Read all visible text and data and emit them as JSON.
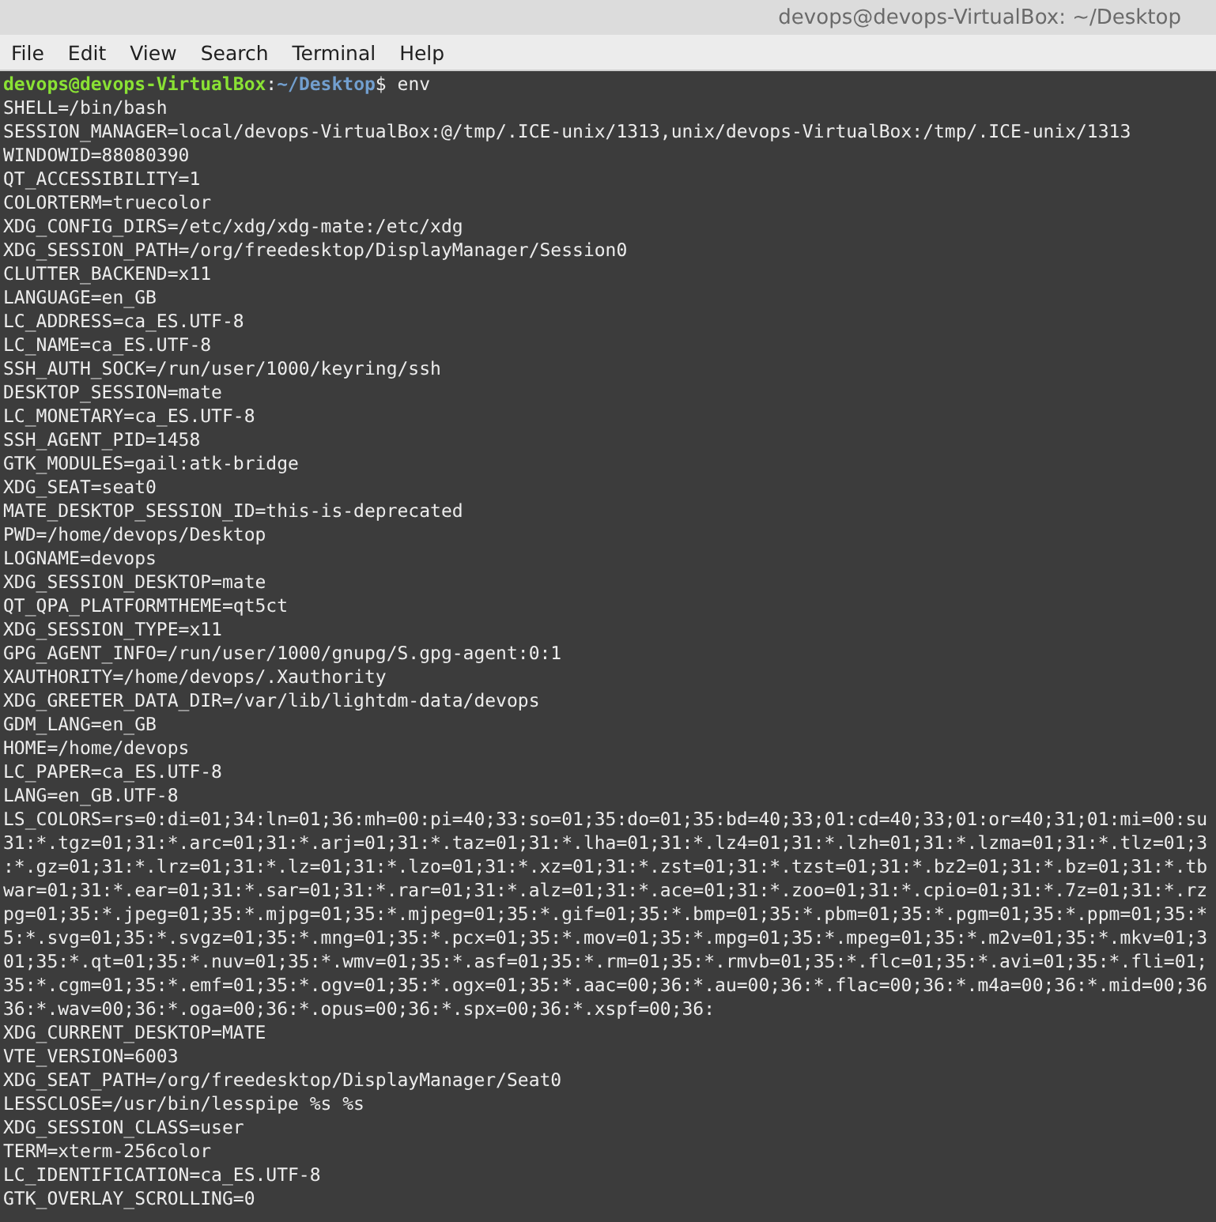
{
  "window": {
    "title": "devops@devops-VirtualBox: ~/Desktop"
  },
  "menu": [
    "File",
    "Edit",
    "View",
    "Search",
    "Terminal",
    "Help"
  ],
  "prompt": {
    "user_host": "devops@devops-VirtualBox",
    "separator": ":",
    "path": "~/Desktop",
    "symbol": "$",
    "command": "env"
  },
  "output_lines": [
    "SHELL=/bin/bash",
    "SESSION_MANAGER=local/devops-VirtualBox:@/tmp/.ICE-unix/1313,unix/devops-VirtualBox:/tmp/.ICE-unix/1313",
    "WINDOWID=88080390",
    "QT_ACCESSIBILITY=1",
    "COLORTERM=truecolor",
    "XDG_CONFIG_DIRS=/etc/xdg/xdg-mate:/etc/xdg",
    "XDG_SESSION_PATH=/org/freedesktop/DisplayManager/Session0",
    "CLUTTER_BACKEND=x11",
    "LANGUAGE=en_GB",
    "LC_ADDRESS=ca_ES.UTF-8",
    "LC_NAME=ca_ES.UTF-8",
    "SSH_AUTH_SOCK=/run/user/1000/keyring/ssh",
    "DESKTOP_SESSION=mate",
    "LC_MONETARY=ca_ES.UTF-8",
    "SSH_AGENT_PID=1458",
    "GTK_MODULES=gail:atk-bridge",
    "XDG_SEAT=seat0",
    "MATE_DESKTOP_SESSION_ID=this-is-deprecated",
    "PWD=/home/devops/Desktop",
    "LOGNAME=devops",
    "XDG_SESSION_DESKTOP=mate",
    "QT_QPA_PLATFORMTHEME=qt5ct",
    "XDG_SESSION_TYPE=x11",
    "GPG_AGENT_INFO=/run/user/1000/gnupg/S.gpg-agent:0:1",
    "XAUTHORITY=/home/devops/.Xauthority",
    "XDG_GREETER_DATA_DIR=/var/lib/lightdm-data/devops",
    "GDM_LANG=en_GB",
    "HOME=/home/devops",
    "LC_PAPER=ca_ES.UTF-8",
    "LANG=en_GB.UTF-8",
    "LS_COLORS=rs=0:di=01;34:ln=01;36:mh=00:pi=40;33:so=01;35:do=01;35:bd=40;33;01:cd=40;33;01:or=40;31;01:mi=00:su",
    "31:*.tgz=01;31:*.arc=01;31:*.arj=01;31:*.taz=01;31:*.lha=01;31:*.lz4=01;31:*.lzh=01;31:*.lzma=01;31:*.tlz=01;3",
    ":*.gz=01;31:*.lrz=01;31:*.lz=01;31:*.lzo=01;31:*.xz=01;31:*.zst=01;31:*.tzst=01;31:*.bz2=01;31:*.bz=01;31:*.tb",
    "war=01;31:*.ear=01;31:*.sar=01;31:*.rar=01;31:*.alz=01;31:*.ace=01;31:*.zoo=01;31:*.cpio=01;31:*.7z=01;31:*.rz",
    "pg=01;35:*.jpeg=01;35:*.mjpg=01;35:*.mjpeg=01;35:*.gif=01;35:*.bmp=01;35:*.pbm=01;35:*.pgm=01;35:*.ppm=01;35:*",
    "5:*.svg=01;35:*.svgz=01;35:*.mng=01;35:*.pcx=01;35:*.mov=01;35:*.mpg=01;35:*.mpeg=01;35:*.m2v=01;35:*.mkv=01;3",
    "01;35:*.qt=01;35:*.nuv=01;35:*.wmv=01;35:*.asf=01;35:*.rm=01;35:*.rmvb=01;35:*.flc=01;35:*.avi=01;35:*.fli=01;",
    "35:*.cgm=01;35:*.emf=01;35:*.ogv=01;35:*.ogx=01;35:*.aac=00;36:*.au=00;36:*.flac=00;36:*.m4a=00;36:*.mid=00;36",
    "36:*.wav=00;36:*.oga=00;36:*.opus=00;36:*.spx=00;36:*.xspf=00;36:",
    "XDG_CURRENT_DESKTOP=MATE",
    "VTE_VERSION=6003",
    "XDG_SEAT_PATH=/org/freedesktop/DisplayManager/Seat0",
    "LESSCLOSE=/usr/bin/lesspipe %s %s",
    "XDG_SESSION_CLASS=user",
    "TERM=xterm-256color",
    "LC_IDENTIFICATION=ca_ES.UTF-8",
    "GTK_OVERLAY_SCROLLING=0"
  ]
}
